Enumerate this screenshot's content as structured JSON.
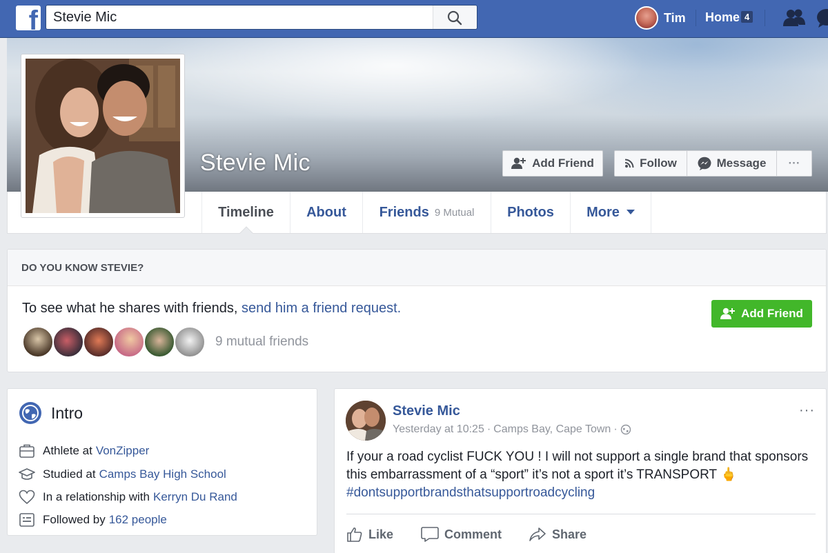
{
  "topbar": {
    "search_value": "Stevie Mic",
    "user_name": "Tim",
    "home_label": "Home",
    "home_badge": "4",
    "logo": "f"
  },
  "profile": {
    "name": "Stevie Mic",
    "buttons": {
      "add_friend": "Add Friend",
      "follow": "Follow",
      "message": "Message",
      "more": "···"
    },
    "tabs": [
      {
        "label": "Timeline"
      },
      {
        "label": "About"
      },
      {
        "label": "Friends",
        "sub": "9 Mutual"
      },
      {
        "label": "Photos"
      },
      {
        "label": "More"
      }
    ]
  },
  "know": {
    "header": "DO YOU KNOW STEVIE?",
    "text": "To see what he shares with friends,",
    "link": "send him a friend request.",
    "add_friend": "Add Friend",
    "mutual_count": "9 mutual friends"
  },
  "intro": {
    "title": "Intro",
    "rows": [
      {
        "prefix": "Athlete at",
        "link": "VonZipper"
      },
      {
        "prefix": "Studied at",
        "link": "Camps Bay High School"
      },
      {
        "prefix": "In a relationship with",
        "link": "Kerryn Du Rand"
      },
      {
        "prefix": "Followed by",
        "link": "162 people"
      }
    ]
  },
  "post": {
    "author": "Stevie Mic",
    "time": "Yesterday at 10:25",
    "location": "Camps Bay, Cape Town",
    "text": "If your a road cyclist FUCK YOU ! I will not support a single brand that sponsors this embarrassment of a “sport” it’s not a sport it’s TRANSPORT",
    "emoji": "🖕",
    "hashtag": "#dontsupportbrandsthatsupportroadcycling",
    "actions": {
      "like": "Like",
      "comment": "Comment",
      "share": "Share"
    },
    "more": "···"
  }
}
